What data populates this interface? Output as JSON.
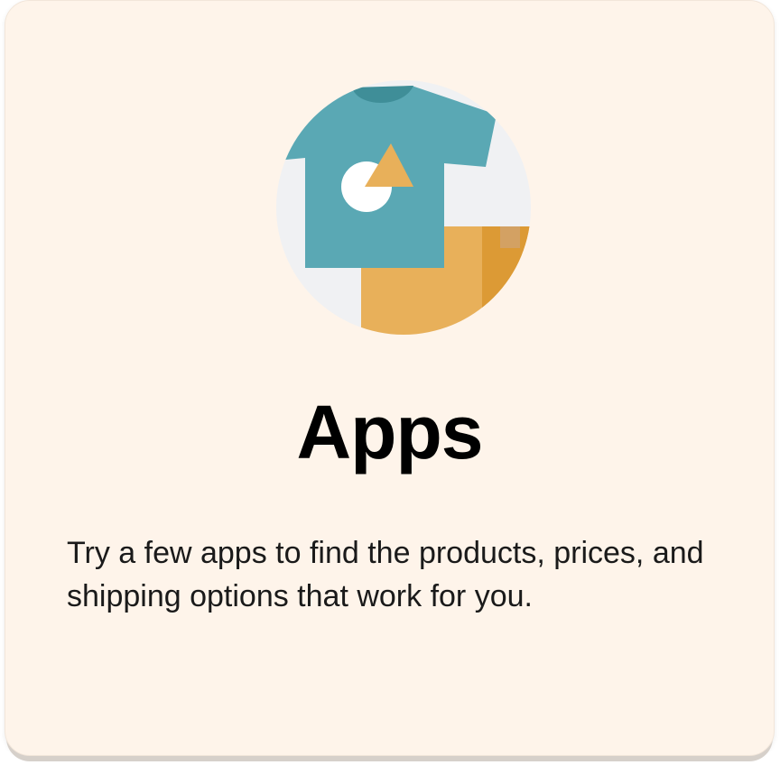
{
  "card": {
    "illustration_icon": "t-shirt-and-box-icon",
    "title": "Apps",
    "description": "Try a few apps to find the products, prices, and shipping options that work for you."
  },
  "colors": {
    "card_background": "#fef4ea",
    "shirt": "#5aa8b4",
    "shirt_collar": "#3f8e98",
    "box": "#e8b05a",
    "box_shade": "#dc9a35",
    "circle_background": "#f0f1f3"
  }
}
